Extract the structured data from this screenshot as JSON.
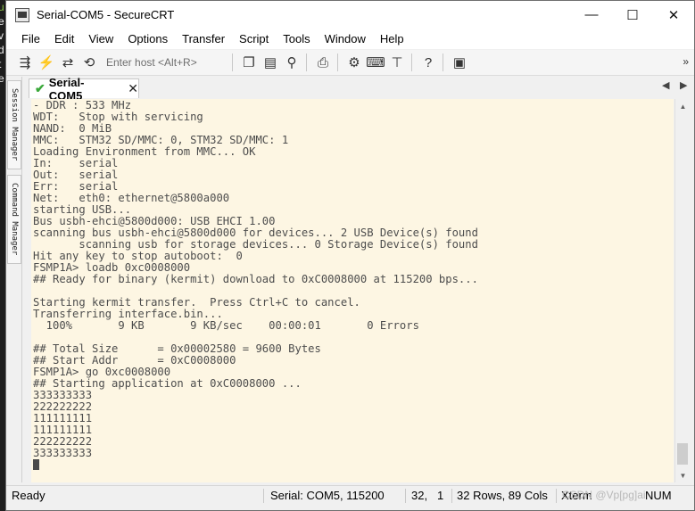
{
  "left_strip": {
    "chars": [
      "u",
      "e",
      "v",
      "d",
      "t",
      "e",
      "l"
    ]
  },
  "window": {
    "title": "Serial-COM5 - SecureCRT",
    "controls": {
      "minimize": "—",
      "maximize": "☐",
      "close": "✕"
    }
  },
  "menu": {
    "items": [
      "File",
      "Edit",
      "View",
      "Options",
      "Transfer",
      "Script",
      "Tools",
      "Window",
      "Help"
    ]
  },
  "toolbar": {
    "host_placeholder": "Enter host <Alt+R>",
    "icons": [
      "connect-icon",
      "lightning-icon",
      "reconnect-icon",
      "disconnect-icon",
      "copy-icon",
      "paste-icon",
      "find-icon",
      "print-icon",
      "settings-icon",
      "keymap-icon",
      "sftp-icon",
      "help-icon",
      "screen-icon"
    ]
  },
  "side_panel": {
    "session_manager": "Session Manager",
    "command_manager": "Command Manager"
  },
  "tab": {
    "label": "Serial-COM5",
    "close": "✕"
  },
  "terminal": {
    "lines": [
      "- DDR : 533 MHz",
      "WDT:   Stop with servicing",
      "NAND:  0 MiB",
      "MMC:   STM32 SD/MMC: 0, STM32 SD/MMC: 1",
      "Loading Environment from MMC... OK",
      "In:    serial",
      "Out:   serial",
      "Err:   serial",
      "Net:   eth0: ethernet@5800a000",
      "starting USB...",
      "Bus usbh-ehci@5800d000: USB EHCI 1.00",
      "scanning bus usbh-ehci@5800d000 for devices... 2 USB Device(s) found",
      "       scanning usb for storage devices... 0 Storage Device(s) found",
      "Hit any key to stop autoboot:  0",
      "FSMP1A> loadb 0xc0008000",
      "## Ready for binary (kermit) download to 0xC0008000 at 115200 bps...",
      "",
      "Starting kermit transfer.  Press Ctrl+C to cancel.",
      "Transferring interface.bin...",
      "  100%       9 KB       9 KB/sec    00:00:01       0 Errors",
      "",
      "## Total Size      = 0x00002580 = 9600 Bytes",
      "## Start Addr      = 0xC0008000",
      "FSMP1A> go 0xc0008000",
      "## Starting application at 0xC0008000 ...",
      "333333333",
      "222222222",
      "111111111",
      "111111111",
      "222222222",
      "333333333"
    ]
  },
  "status": {
    "ready": "Ready",
    "serial": "Serial: COM5, 115200",
    "row": "32,",
    "col": "1",
    "size": "32 Rows, 89 Cols",
    "term": "Xterm",
    "num": "NUM",
    "watermark": "CSDN @Vp[pg]ai"
  }
}
